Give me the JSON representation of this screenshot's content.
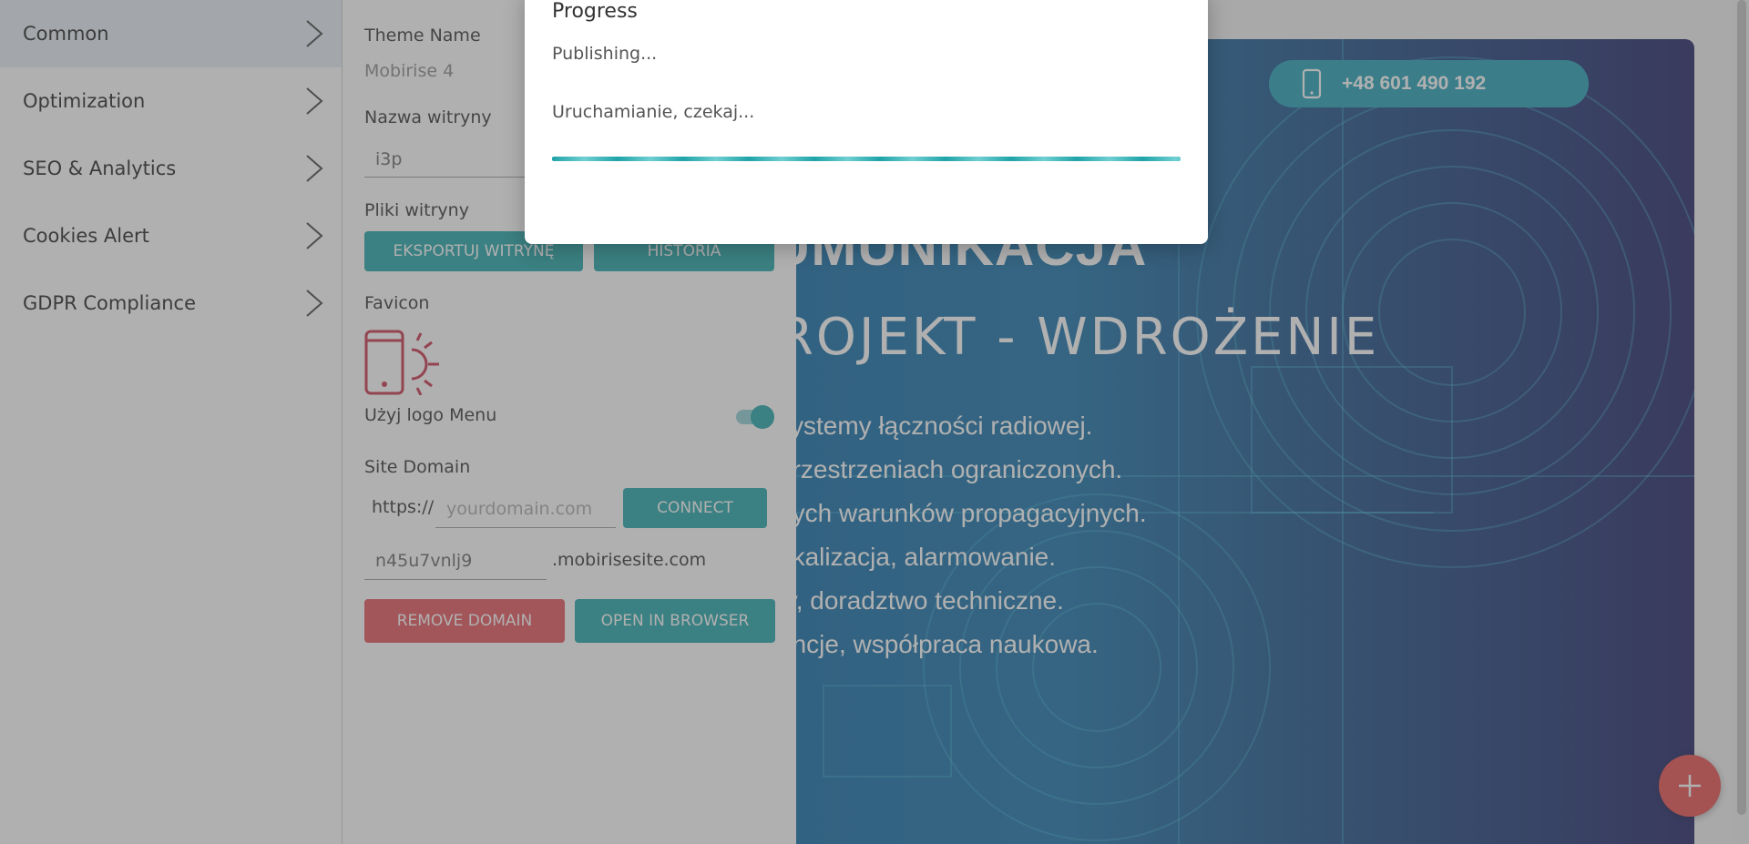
{
  "sidebar": {
    "items": [
      {
        "label": "Common"
      },
      {
        "label": "Optimization"
      },
      {
        "label": "SEO & Analytics"
      },
      {
        "label": "Cookies Alert"
      },
      {
        "label": "GDPR Compliance"
      }
    ]
  },
  "settings": {
    "theme_name_label": "Theme Name",
    "theme_name_value": "Mobirise 4",
    "site_name_label": "Nazwa witryny",
    "site_name_value": "i3p",
    "site_files_label": "Pliki witryny",
    "export_button": "EKSPORTUJ WITRYNĘ",
    "history_button": "HISTORIA",
    "favicon_label": "Favicon",
    "use_logo_label": "Użyj logo Menu",
    "use_logo_on": true,
    "site_domain_label": "Site Domain",
    "https_prefix": "https://",
    "domain_placeholder": "yourdomain.com",
    "connect_button": "CONNECT",
    "subdomain_value": "n45u7vnlj9",
    "subdomain_suffix": ".mobirisesite.com",
    "remove_domain_button": "REMOVE DOMAIN",
    "open_browser_button": "OPEN IN BROWSER"
  },
  "preview": {
    "phone": "+48 601 490 192",
    "heading": "UMUNIKACJA",
    "subheading": "ROJEKT - WDROŻENIE",
    "lines": [
      "systemy łączności radiowej.",
      "przestrzeniach ograniczonych.",
      "nych warunków propagacyjnych.",
      "okalizacja, alarmowanie.",
      "ty, doradztwo techniczne.",
      "encje, współpraca naukowa."
    ]
  },
  "modal": {
    "title": "Progress",
    "subtitle": "Publishing...",
    "message": "Uruchamianie, czekaj..."
  },
  "colors": {
    "accent": "#1fa3a8",
    "danger": "#e7535a",
    "icon_red": "#c8324a"
  },
  "icons": [
    "chevron-right-icon",
    "phone-sun-favicon-icon",
    "phone-icon",
    "plus-icon"
  ]
}
